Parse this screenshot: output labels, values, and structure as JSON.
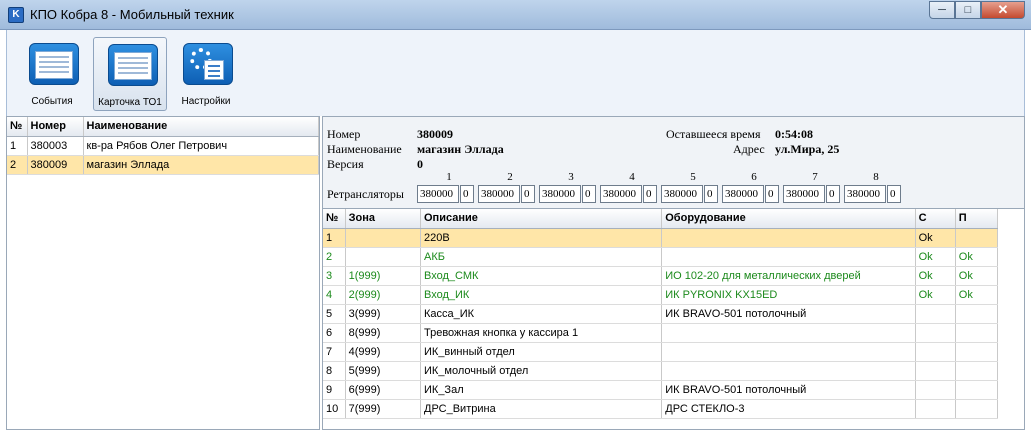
{
  "window": {
    "title": "КПО Кобра 8 - Мобильный техник"
  },
  "toolbar": {
    "buttons": [
      {
        "label": "События",
        "icon": "events-icon"
      },
      {
        "label": "Карточка ТО1",
        "icon": "card-icon"
      },
      {
        "label": "Настройки",
        "icon": "settings-icon"
      }
    ]
  },
  "objects_list": {
    "headers": [
      "№",
      "Номер",
      "Наименование"
    ],
    "rows": [
      {
        "n": "1",
        "number": "380003",
        "name": "кв-ра Рябов Олег Петрович"
      },
      {
        "n": "2",
        "number": "380009",
        "name": "магазин Эллада"
      }
    ]
  },
  "object_info": {
    "number_label": "Номер",
    "number": "380009",
    "name_label": "Наименование",
    "name": "магазин Эллада",
    "version_label": "Версия",
    "version": "0",
    "time_left_label": "Оставшееся время",
    "time_left": "0:54:08",
    "address_label": "Адрес",
    "address": "ул.Мира, 25",
    "repeaters_label": "Ретрансляторы",
    "repeaters": [
      {
        "n": "1",
        "value": "380000",
        "sub": "0"
      },
      {
        "n": "2",
        "value": "380000",
        "sub": "0"
      },
      {
        "n": "3",
        "value": "380000",
        "sub": "0"
      },
      {
        "n": "4",
        "value": "380000",
        "sub": "0"
      },
      {
        "n": "5",
        "value": "380000",
        "sub": "0"
      },
      {
        "n": "6",
        "value": "380000",
        "sub": "0"
      },
      {
        "n": "7",
        "value": "380000",
        "sub": "0"
      },
      {
        "n": "8",
        "value": "380000",
        "sub": "0"
      }
    ]
  },
  "zones": {
    "headers": [
      "№",
      "Зона",
      "Описание",
      "Оборудование",
      "С",
      "П"
    ],
    "rows": [
      {
        "n": "1",
        "zone": "",
        "desc": "220В",
        "equip": "",
        "c": "Ok",
        "p": ""
      },
      {
        "n": "2",
        "zone": "",
        "desc": "АКБ",
        "equip": "",
        "c": "Ok",
        "p": "Ok"
      },
      {
        "n": "3",
        "zone": "1(999)",
        "desc": "Вход_СМК",
        "equip": "ИО 102-20 для металлических дверей",
        "c": "Ok",
        "p": "Ok"
      },
      {
        "n": "4",
        "zone": "2(999)",
        "desc": "Вход_ИК",
        "equip": "ИК PYRONIX KX15ED",
        "c": "Ok",
        "p": "Ok"
      },
      {
        "n": "5",
        "zone": "3(999)",
        "desc": "Касса_ИК",
        "equip": "ИК BRAVO-501 потолочный",
        "c": "",
        "p": ""
      },
      {
        "n": "6",
        "zone": "8(999)",
        "desc": "Тревожная кнопка у кассира 1",
        "equip": "",
        "c": "",
        "p": ""
      },
      {
        "n": "7",
        "zone": "4(999)",
        "desc": "ИК_винный отдел",
        "equip": "",
        "c": "",
        "p": ""
      },
      {
        "n": "8",
        "zone": "5(999)",
        "desc": "ИК_молочный отдел",
        "equip": "",
        "c": "",
        "p": ""
      },
      {
        "n": "9",
        "zone": "6(999)",
        "desc": "ИК_Зал",
        "equip": "ИК BRAVO-501 потолочный",
        "c": "",
        "p": ""
      },
      {
        "n": "10",
        "zone": "7(999)",
        "desc": "ДРС_Витрина",
        "equip": "ДРС СТЕКЛО-3",
        "c": "",
        "p": ""
      }
    ]
  }
}
